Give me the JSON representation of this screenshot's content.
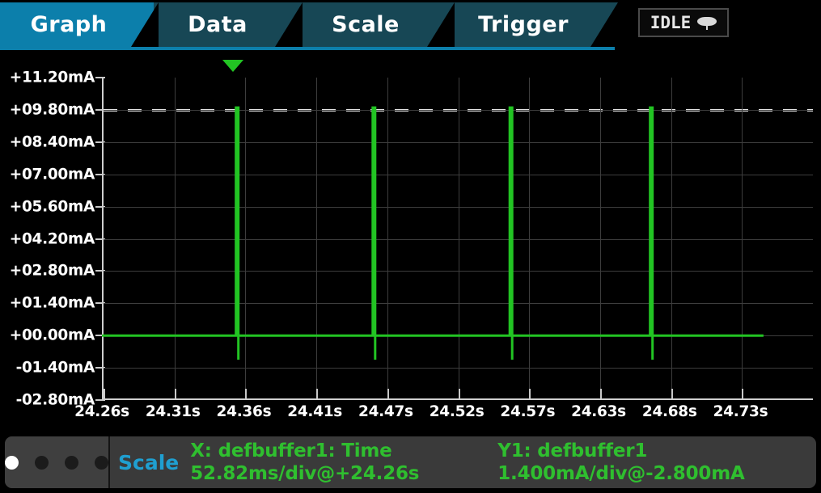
{
  "tabs": [
    {
      "label": "Graph",
      "active": true
    },
    {
      "label": "Data",
      "active": false
    },
    {
      "label": "Scale",
      "active": false
    },
    {
      "label": "Trigger",
      "active": false
    }
  ],
  "status_indicator": {
    "label": "IDLE",
    "icon": "trigger-idle-icon"
  },
  "colors": {
    "accent_active_tab": "#0c7fab",
    "inactive_tab": "#174755",
    "trace": "#22c423",
    "readout_text": "#2fbf2f",
    "scale_label": "#1f9fd0",
    "grid": "#3d3d3d",
    "axis": "#cfcfcf",
    "cursor": "#e2e2e2"
  },
  "statusbar": {
    "page_dots": {
      "count": 4,
      "active_index": 0
    },
    "scale_label": "Scale",
    "x_channel": "X: defbuffer1: Time",
    "x_scale": "52.82ms/div@+24.26s",
    "y_channel": "Y1: defbuffer1",
    "y_scale": "1.400mA/div@-2.800mA"
  },
  "chart_data": {
    "type": "line",
    "title": "",
    "xlabel": "",
    "ylabel": "",
    "x_unit": "s",
    "y_unit": "mA",
    "xlim": [
      24.26,
      24.7893
    ],
    "ylim": [
      -2.8,
      11.2
    ],
    "grid": true,
    "x_per_div": 0.05282,
    "y_per_div": 1.4,
    "x_ticks": [
      "24.26s",
      "24.31s",
      "24.36s",
      "24.41s",
      "24.47s",
      "24.52s",
      "24.57s",
      "24.63s",
      "24.68s",
      "24.73s"
    ],
    "x_tick_values": [
      24.26,
      24.31282,
      24.36564,
      24.41846,
      24.47128,
      24.5241,
      24.57692,
      24.62974,
      24.68256,
      24.73538
    ],
    "y_ticks": [
      "+11.20mA",
      "+09.80mA",
      "+08.40mA",
      "+07.00mA",
      "+05.60mA",
      "+04.20mA",
      "+02.80mA",
      "+01.40mA",
      "+00.00mA",
      "-01.40mA",
      "-02.80mA"
    ],
    "y_tick_values": [
      11.2,
      9.8,
      8.4,
      7.0,
      5.6,
      4.2,
      2.8,
      1.4,
      0.0,
      -1.4,
      -2.8
    ],
    "cursor_level_mA": 9.8,
    "trigger_marker_time_s": 24.3577,
    "baseline_mA": 0.0,
    "trace_end_time_s": 24.7525,
    "series": [
      {
        "name": "defbuffer1 current",
        "color": "#22c423",
        "pulses": [
          {
            "time_s": 24.3607,
            "peak_mA": 9.9,
            "undershoot_mA": -1.05,
            "width_s": 0.0018
          },
          {
            "time_s": 24.4625,
            "peak_mA": 9.9,
            "undershoot_mA": -1.05,
            "width_s": 0.0018
          },
          {
            "time_s": 24.5645,
            "peak_mA": 9.9,
            "undershoot_mA": -1.05,
            "width_s": 0.0018
          },
          {
            "time_s": 24.669,
            "peak_mA": 9.9,
            "undershoot_mA": -1.05,
            "width_s": 0.0018
          }
        ]
      }
    ]
  }
}
